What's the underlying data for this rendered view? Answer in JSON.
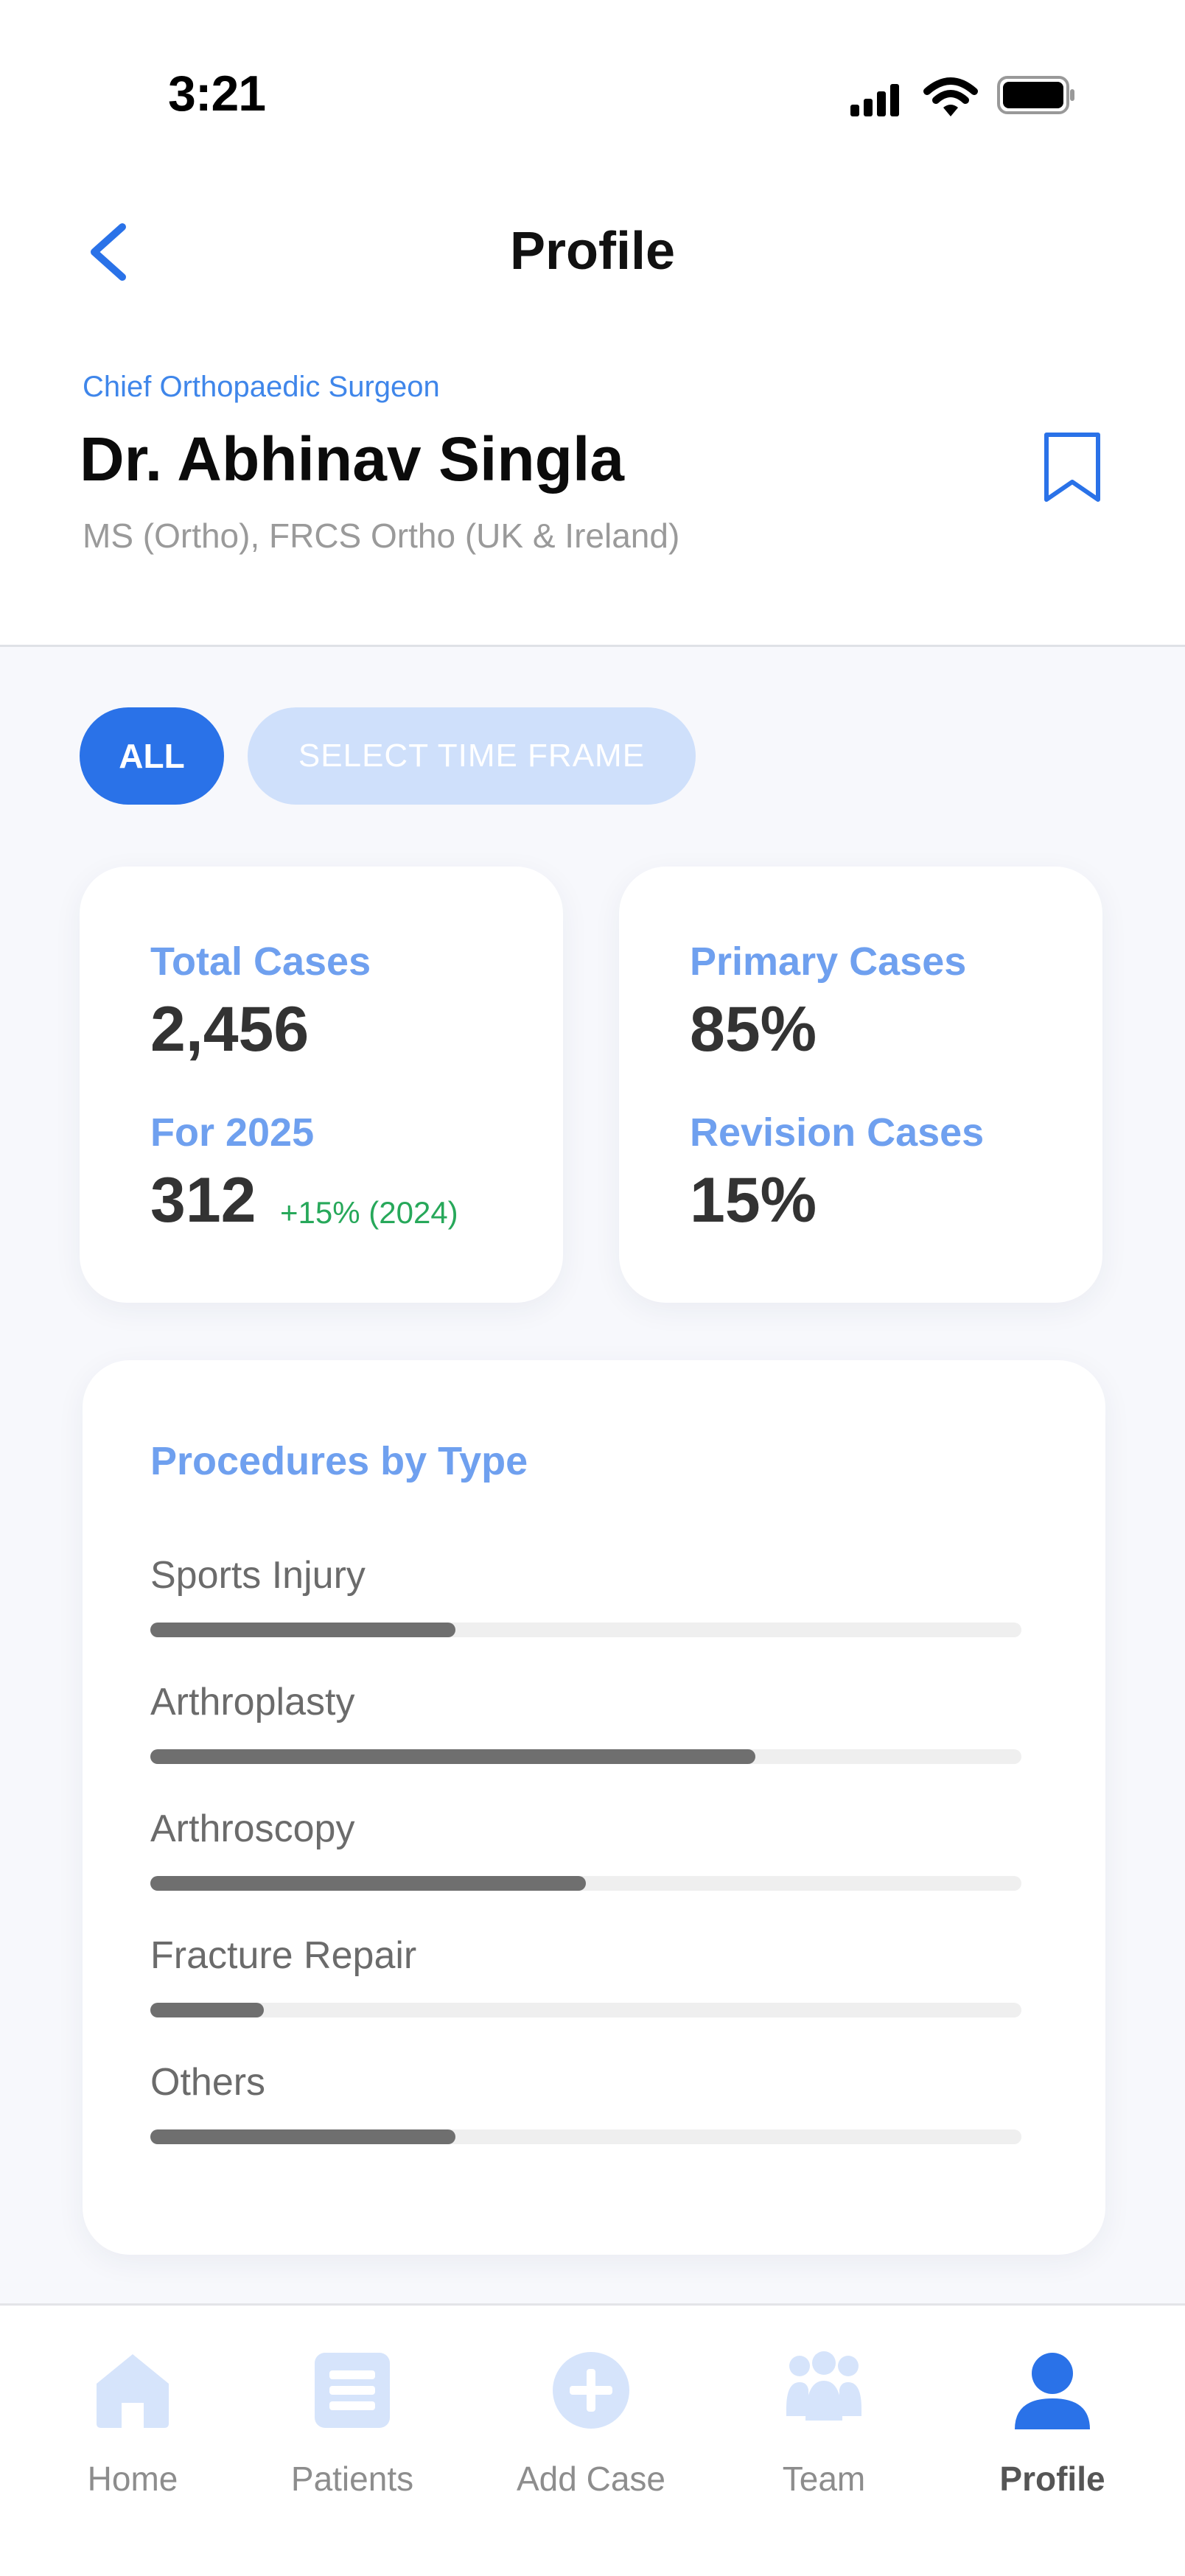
{
  "status_bar": {
    "time": "3:21"
  },
  "header": {
    "title": "Profile"
  },
  "profile": {
    "role": "Chief Orthopaedic Surgeon",
    "name": "Dr. Abhinav Singla",
    "qualifications": "MS (Ortho), FRCS Ortho (UK & Ireland)"
  },
  "filters": {
    "all_label": "ALL",
    "time_frame_label": "SELECT TIME FRAME"
  },
  "stats": {
    "total_cases_label": "Total Cases",
    "total_cases_value": "2,456",
    "year_label": "For 2025",
    "year_value": "312",
    "year_delta": "+15% (2024)",
    "primary_label": "Primary Cases",
    "primary_value": "85%",
    "revision_label": "Revision Cases",
    "revision_value": "15%"
  },
  "procedures": {
    "title": "Procedures by Type",
    "items": [
      {
        "label": "Sports Injury",
        "fraction": 0.35
      },
      {
        "label": "Arthroplasty",
        "fraction": 0.695
      },
      {
        "label": "Arthroscopy",
        "fraction": 0.5
      },
      {
        "label": "Fracture Repair",
        "fraction": 0.13
      },
      {
        "label": "Others",
        "fraction": 0.35
      }
    ]
  },
  "tabbar": {
    "items": [
      {
        "label": "Home",
        "icon": "home-icon"
      },
      {
        "label": "Patients",
        "icon": "list-icon"
      },
      {
        "label": "Add Case",
        "icon": "plus-circle-icon"
      },
      {
        "label": "Team",
        "icon": "team-icon"
      },
      {
        "label": "Profile",
        "icon": "person-icon"
      }
    ],
    "active": "Profile"
  },
  "colors": {
    "accent": "#2a72e8",
    "accent_light": "#cfe0fb",
    "label_blue": "#6fa0ef",
    "positive": "#27a85a",
    "inactive_icon": "#d6e4fb"
  }
}
